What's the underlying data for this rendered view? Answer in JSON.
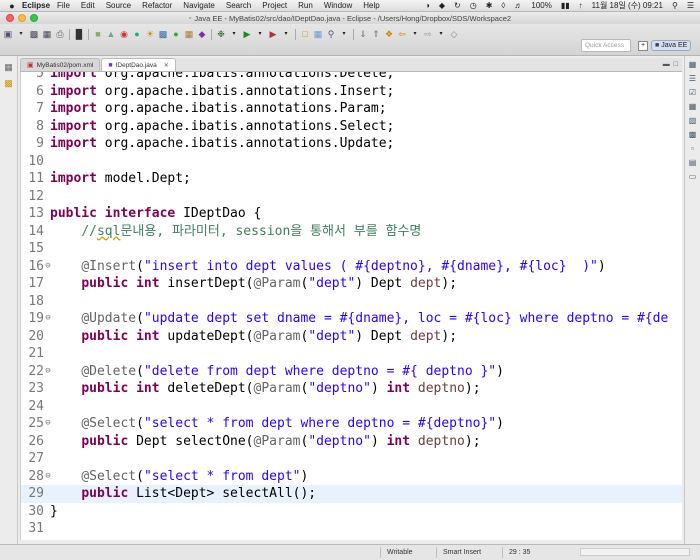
{
  "menubar": {
    "app_name": "Eclipse",
    "items": [
      "File",
      "Edit",
      "Source",
      "Refactor",
      "Navigate",
      "Search",
      "Project",
      "Run",
      "Window",
      "Help"
    ],
    "battery": "100%",
    "datetime": "11월 18일 (수)  09:21"
  },
  "window": {
    "title": "Java EE - MyBatis02/src/dao/IDeptDao.java - Eclipse - /Users/Hong/Dropbox/SDS/Workspace2"
  },
  "toolbar": {
    "quick_access_placeholder": "Quick Access",
    "perspective_label": "Java EE"
  },
  "tabs": [
    {
      "label": "MyBatis02/pom.xml",
      "active": false
    },
    {
      "label": "IDeptDao.java",
      "active": true
    }
  ],
  "editor": {
    "current_line": "29",
    "lines": [
      {
        "num": "5",
        "text": "import org.apache.ibatis.annotations.Delete;"
      },
      {
        "num": "6",
        "text": "import org.apache.ibatis.annotations.Insert;"
      },
      {
        "num": "7",
        "text": "import org.apache.ibatis.annotations.Param;"
      },
      {
        "num": "8",
        "text": "import org.apache.ibatis.annotations.Select;"
      },
      {
        "num": "9",
        "text": "import org.apache.ibatis.annotations.Update;"
      },
      {
        "num": "10",
        "text": ""
      },
      {
        "num": "11",
        "text": "import model.Dept;"
      },
      {
        "num": "12",
        "text": ""
      },
      {
        "num": "13",
        "text": "public interface IDeptDao {"
      },
      {
        "num": "14",
        "text": "    //sql문내용, 파라미터, session을 통해서 부를 함수명"
      },
      {
        "num": "15",
        "text": ""
      },
      {
        "num": "16",
        "text": "    @Insert(\"insert into dept values ( #{deptno}, #{dname}, #{loc}  )\")"
      },
      {
        "num": "17",
        "text": "    public int insertDept(@Param(\"dept\") Dept dept);"
      },
      {
        "num": "18",
        "text": ""
      },
      {
        "num": "19",
        "text": "    @Update(\"update dept set dname = #{dname}, loc = #{loc} where deptno = #{de"
      },
      {
        "num": "20",
        "text": "    public int updateDept(@Param(\"dept\") Dept dept);"
      },
      {
        "num": "21",
        "text": ""
      },
      {
        "num": "22",
        "text": "    @Delete(\"delete from dept where deptno = #{ deptno }\")"
      },
      {
        "num": "23",
        "text": "    public int deleteDept(@Param(\"deptno\") int deptno);"
      },
      {
        "num": "24",
        "text": ""
      },
      {
        "num": "25",
        "text": "    @Select(\"select * from dept where deptno = #{deptno}\")"
      },
      {
        "num": "26",
        "text": "    public Dept selectOne(@Param(\"deptno\") int deptno);"
      },
      {
        "num": "27",
        "text": ""
      },
      {
        "num": "28",
        "text": "    @Select(\"select * from dept\")"
      },
      {
        "num": "29",
        "text": "    public List<Dept> selectAll();"
      },
      {
        "num": "30",
        "text": "}"
      },
      {
        "num": "31",
        "text": ""
      }
    ]
  },
  "statusbar": {
    "writable": "Writable",
    "insert_mode": "Smart Insert",
    "position": "29 : 35"
  }
}
